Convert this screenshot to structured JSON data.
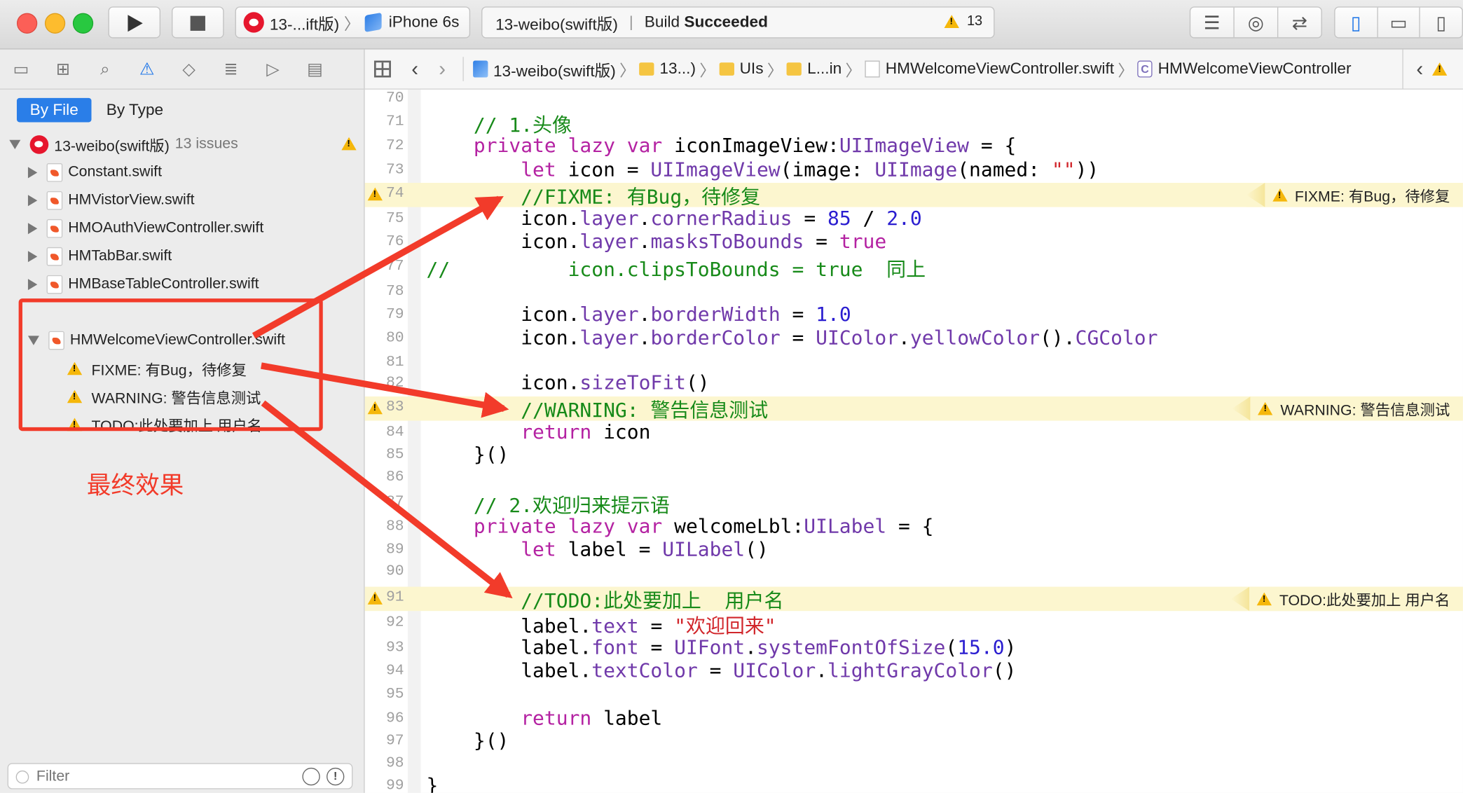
{
  "toolbar": {
    "scheme_name": "13-...ift版)",
    "device": "iPhone 6s",
    "activity_project": "13-weibo(swift版)",
    "activity_status_prefix": "Build",
    "activity_status": "Succeeded",
    "warning_count": "13"
  },
  "navigator": {
    "scope_by_file": "By File",
    "scope_by_type": "By Type",
    "project": "13-weibo(swift版)",
    "issue_count": "13 issues",
    "files": [
      {
        "name": "Constant.swift"
      },
      {
        "name": "HMVistorView.swift"
      },
      {
        "name": "HMOAuthViewController.swift"
      },
      {
        "name": "HMTabBar.swift"
      },
      {
        "name": "HMBaseTableController.swift"
      },
      {
        "name": "HMWelcomeViewController.swift"
      }
    ],
    "issues": [
      {
        "text": "FIXME: 有Bug，待修复"
      },
      {
        "text": "WARNING: 警告信息测试"
      },
      {
        "text": "TODO:此处要加上 用户名"
      }
    ],
    "filter_placeholder": "Filter"
  },
  "jumpbar": {
    "crumbs": [
      "13-weibo(swift版)",
      "13...)",
      "UIs",
      "L...in",
      "HMWelcomeViewController.swift",
      "HMWelcomeViewController"
    ]
  },
  "editor": {
    "lines": [
      {
        "n": "70",
        "tokens": []
      },
      {
        "n": "71",
        "tokens": [
          {
            "c": "cm",
            "t": "    // 1.头像"
          }
        ]
      },
      {
        "n": "72",
        "tokens": [
          {
            "c": "kw",
            "t": "    private lazy var"
          },
          {
            "c": "",
            "t": " iconImageView:"
          },
          {
            "c": "ty",
            "t": "UIImageView"
          },
          {
            "c": "",
            "t": " = {"
          }
        ]
      },
      {
        "n": "73",
        "tokens": [
          {
            "c": "kw",
            "t": "        let"
          },
          {
            "c": "",
            "t": " icon = "
          },
          {
            "c": "ty",
            "t": "UIImageView"
          },
          {
            "c": "",
            "t": "(image: "
          },
          {
            "c": "ty",
            "t": "UIImage"
          },
          {
            "c": "",
            "t": "(named: "
          },
          {
            "c": "st",
            "t": "\"\""
          },
          {
            "c": "",
            "t": "))"
          }
        ]
      },
      {
        "n": "74",
        "warn": true,
        "badge": "FIXME: 有Bug，待修复",
        "tokens": [
          {
            "c": "cm",
            "t": "        //FIXME: 有Bug，待修复"
          }
        ]
      },
      {
        "n": "75",
        "tokens": [
          {
            "c": "",
            "t": "        icon."
          },
          {
            "c": "ty",
            "t": "layer"
          },
          {
            "c": "",
            "t": "."
          },
          {
            "c": "ty",
            "t": "cornerRadius"
          },
          {
            "c": "",
            "t": " = "
          },
          {
            "c": "nu",
            "t": "85"
          },
          {
            "c": "",
            "t": " / "
          },
          {
            "c": "nu",
            "t": "2.0"
          }
        ]
      },
      {
        "n": "76",
        "tokens": [
          {
            "c": "",
            "t": "        icon."
          },
          {
            "c": "ty",
            "t": "layer"
          },
          {
            "c": "",
            "t": "."
          },
          {
            "c": "ty",
            "t": "masksToBounds"
          },
          {
            "c": "",
            "t": " = "
          },
          {
            "c": "kw",
            "t": "true"
          }
        ]
      },
      {
        "n": "77",
        "tokens": [
          {
            "c": "cm",
            "t": "//          icon.clipsToBounds = true  同上"
          }
        ]
      },
      {
        "n": "78",
        "tokens": []
      },
      {
        "n": "79",
        "tokens": [
          {
            "c": "",
            "t": "        icon."
          },
          {
            "c": "ty",
            "t": "layer"
          },
          {
            "c": "",
            "t": "."
          },
          {
            "c": "ty",
            "t": "borderWidth"
          },
          {
            "c": "",
            "t": " = "
          },
          {
            "c": "nu",
            "t": "1.0"
          }
        ]
      },
      {
        "n": "80",
        "tokens": [
          {
            "c": "",
            "t": "        icon."
          },
          {
            "c": "ty",
            "t": "layer"
          },
          {
            "c": "",
            "t": "."
          },
          {
            "c": "ty",
            "t": "borderColor"
          },
          {
            "c": "",
            "t": " = "
          },
          {
            "c": "ty",
            "t": "UIColor"
          },
          {
            "c": "",
            "t": "."
          },
          {
            "c": "ty",
            "t": "yellowColor"
          },
          {
            "c": "",
            "t": "()."
          },
          {
            "c": "ty",
            "t": "CGColor"
          }
        ]
      },
      {
        "n": "81",
        "tokens": []
      },
      {
        "n": "82",
        "tokens": [
          {
            "c": "",
            "t": "        icon."
          },
          {
            "c": "ty",
            "t": "sizeToFit"
          },
          {
            "c": "",
            "t": "()"
          }
        ]
      },
      {
        "n": "83",
        "warn": true,
        "badge": "WARNING: 警告信息测试",
        "tokens": [
          {
            "c": "cm",
            "t": "        //WARNING: 警告信息测试"
          }
        ]
      },
      {
        "n": "84",
        "tokens": [
          {
            "c": "kw",
            "t": "        return"
          },
          {
            "c": "",
            "t": " icon"
          }
        ]
      },
      {
        "n": "85",
        "tokens": [
          {
            "c": "",
            "t": "    }()"
          }
        ]
      },
      {
        "n": "86",
        "tokens": []
      },
      {
        "n": "87",
        "tokens": [
          {
            "c": "cm",
            "t": "    // 2.欢迎归来提示语"
          }
        ]
      },
      {
        "n": "88",
        "tokens": [
          {
            "c": "kw",
            "t": "    private lazy var"
          },
          {
            "c": "",
            "t": " welcomeLbl:"
          },
          {
            "c": "ty",
            "t": "UILabel"
          },
          {
            "c": "",
            "t": " = {"
          }
        ]
      },
      {
        "n": "89",
        "tokens": [
          {
            "c": "kw",
            "t": "        let"
          },
          {
            "c": "",
            "t": " label = "
          },
          {
            "c": "ty",
            "t": "UILabel"
          },
          {
            "c": "",
            "t": "()"
          }
        ]
      },
      {
        "n": "90",
        "tokens": []
      },
      {
        "n": "91",
        "warn": true,
        "badge": "TODO:此处要加上 用户名",
        "tokens": [
          {
            "c": "cm",
            "t": "        //TODO:此处要加上  用户名"
          }
        ]
      },
      {
        "n": "92",
        "tokens": [
          {
            "c": "",
            "t": "        label."
          },
          {
            "c": "ty",
            "t": "text"
          },
          {
            "c": "",
            "t": " = "
          },
          {
            "c": "st",
            "t": "\"欢迎回来\""
          }
        ]
      },
      {
        "n": "93",
        "tokens": [
          {
            "c": "",
            "t": "        label."
          },
          {
            "c": "ty",
            "t": "font"
          },
          {
            "c": "",
            "t": " = "
          },
          {
            "c": "ty",
            "t": "UIFont"
          },
          {
            "c": "",
            "t": "."
          },
          {
            "c": "ty",
            "t": "systemFontOfSize"
          },
          {
            "c": "",
            "t": "("
          },
          {
            "c": "nu",
            "t": "15.0"
          },
          {
            "c": "",
            "t": ")"
          }
        ]
      },
      {
        "n": "94",
        "tokens": [
          {
            "c": "",
            "t": "        label."
          },
          {
            "c": "ty",
            "t": "textColor"
          },
          {
            "c": "",
            "t": " = "
          },
          {
            "c": "ty",
            "t": "UIColor"
          },
          {
            "c": "",
            "t": "."
          },
          {
            "c": "ty",
            "t": "lightGrayColor"
          },
          {
            "c": "",
            "t": "()"
          }
        ]
      },
      {
        "n": "95",
        "tokens": []
      },
      {
        "n": "96",
        "tokens": [
          {
            "c": "kw",
            "t": "        return"
          },
          {
            "c": "",
            "t": " label"
          }
        ]
      },
      {
        "n": "97",
        "tokens": [
          {
            "c": "",
            "t": "    }()"
          }
        ]
      },
      {
        "n": "98",
        "tokens": []
      },
      {
        "n": "99",
        "tokens": [
          {
            "c": "",
            "t": "}"
          }
        ]
      }
    ]
  },
  "annotation": {
    "label": "最终效果",
    "color": "#f23b2a"
  }
}
